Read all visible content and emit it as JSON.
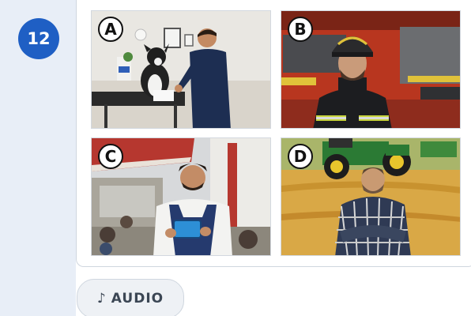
{
  "question": {
    "number": "12"
  },
  "options": [
    {
      "letter": "A",
      "image": "veterinarian examining a dog"
    },
    {
      "letter": "B",
      "image": "firefighter in front of a fire truck"
    },
    {
      "letter": "C",
      "image": "waiter holding a tablet at a cafe"
    },
    {
      "letter": "D",
      "image": "farmer with a tractor in a wheat field"
    }
  ],
  "audio_button": {
    "icon": "music-note-icon",
    "icon_glyph": "♪",
    "label": "AUDIO"
  },
  "colors": {
    "accent": "#1f5fc4",
    "side_panel": "#e8eef7",
    "border": "#cfd6df"
  }
}
